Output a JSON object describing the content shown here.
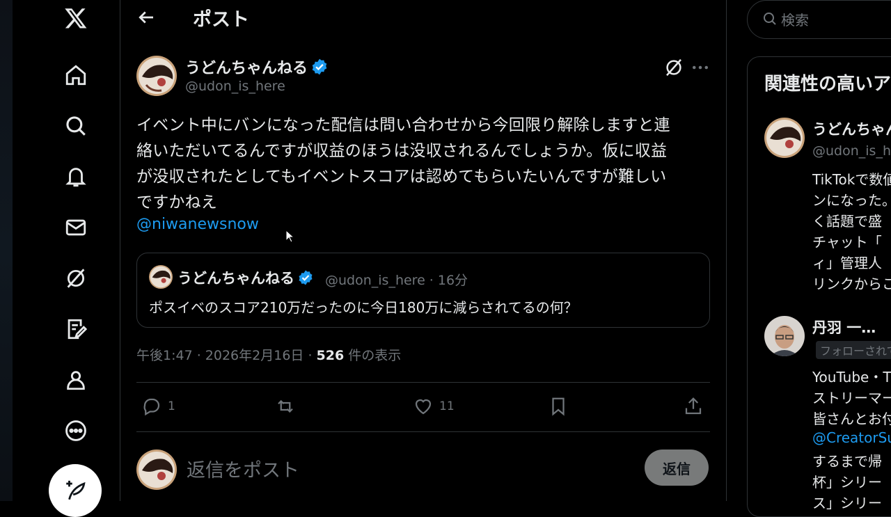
{
  "header": {
    "title": "ポスト"
  },
  "post": {
    "author_name": "うどんちゃんねる",
    "author_handle": "@udon_is_here",
    "text_lines": [
      "イベント中にバンになった配信は問い合わせから今回限り解除しますと連",
      "絡いただいてるんですが収益のほうは没収されるんでしょうか。仮に収益",
      "が没収されたとしてもイベントスコアは認めてもらいたいんですが難しい",
      "ですかねえ"
    ],
    "mention": "@niwanewsnow",
    "quote": {
      "author_name": "うどんちゃんねる",
      "meta": "@udon_is_here · 16分",
      "text": "ポスイベのスコア210万だったのに今日180万に減らされてるの何？"
    },
    "timestamp": "午後1:47 · 2026年2月16日 · ",
    "views_count": "526",
    "views_label": " 件の表示",
    "replies": "1",
    "likes": "11"
  },
  "reply_box": {
    "placeholder": "返信をポスト",
    "button": "返信"
  },
  "search": {
    "placeholder": "検索"
  },
  "sidebar": {
    "title": "関連性の高いア",
    "users": [
      {
        "name": "うどんちゃん",
        "handle": "@udon_is_h",
        "bio_lines": [
          "TikTokで数値",
          "ンになった。",
          "く話題で盛",
          "チャット「",
          "ィ」管理人",
          "リンクからこ"
        ]
      },
      {
        "name": "丹羽 一…",
        "badge": "フォローされて",
        "bio_lines": [
          "YouTube・T",
          "ストリーマー",
          "皆さんとお付",
          "@CreatorSu",
          "するまで帰",
          "杯」シリー",
          "ス」シリー"
        ]
      }
    ]
  },
  "colors": {
    "accent": "#1d9bf0",
    "muted": "#71767b",
    "border": "#2f3336"
  }
}
